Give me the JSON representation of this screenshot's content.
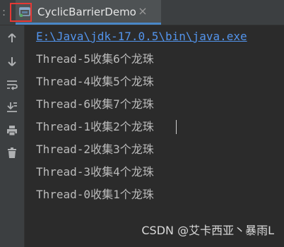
{
  "editor_tabs": {
    "prefix_glyph": ":",
    "active_tab": {
      "title": "CyclicBarrierDemo",
      "icon": "run-console-icon",
      "close_glyph": "×"
    },
    "accent_color": "#4a88c7",
    "highlight_color": "#e53935"
  },
  "toolbar": {
    "buttons": [
      {
        "name": "scroll-up",
        "icon": "arrow-up-icon"
      },
      {
        "name": "scroll-down",
        "icon": "arrow-down-icon"
      },
      {
        "name": "soft-wrap",
        "icon": "soft-wrap-icon"
      },
      {
        "name": "scroll-to-end",
        "icon": "scroll-to-end-icon"
      },
      {
        "name": "print",
        "icon": "print-icon"
      },
      {
        "name": "clear-all",
        "icon": "trash-icon"
      }
    ]
  },
  "console": {
    "command_line": "E:\\Java\\jdk-17.0.5\\bin\\java.exe",
    "output_lines": [
      "Thread-5收集6个龙珠",
      "Thread-4收集5个龙珠",
      "Thread-6收集7个龙珠",
      "Thread-1收集2个龙珠",
      "Thread-2收集3个龙珠",
      "Thread-3收集4个龙珠",
      "Thread-0收集1个龙珠"
    ],
    "text_color": "#bbbbbb",
    "link_color": "#5394ec"
  },
  "watermark": "CSDN @艾卡西亚丶暴雨L"
}
